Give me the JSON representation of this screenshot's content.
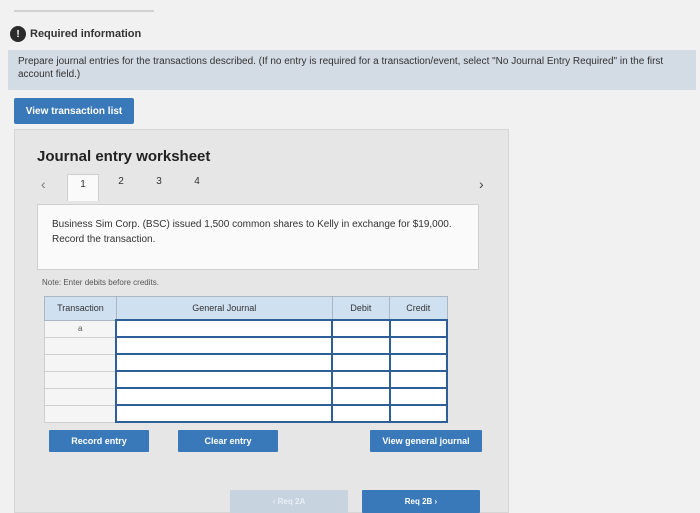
{
  "header": {
    "icon_glyph": "!",
    "title": "Required information"
  },
  "instructions": "Prepare journal entries for the transactions described. (If no entry is required for a transaction/event, select \"No Journal Entry Required\" in the first account field.)",
  "view_transaction_list": "View transaction list",
  "worksheet": {
    "title": "Journal entry worksheet",
    "tabs": [
      "1",
      "2",
      "3",
      "4"
    ],
    "active_tab": "1",
    "description": "Business Sim Corp. (BSC) issued 1,500 common shares to Kelly in exchange for $19,000. Record the transaction.",
    "note": "Note: Enter debits before credits.",
    "table": {
      "headers": [
        "Transaction",
        "General Journal",
        "Debit",
        "Credit"
      ],
      "rows": [
        {
          "transaction": "a",
          "account": "",
          "debit": "",
          "credit": ""
        },
        {
          "transaction": "",
          "account": "",
          "debit": "",
          "credit": ""
        },
        {
          "transaction": "",
          "account": "",
          "debit": "",
          "credit": ""
        },
        {
          "transaction": "",
          "account": "",
          "debit": "",
          "credit": ""
        },
        {
          "transaction": "",
          "account": "",
          "debit": "",
          "credit": ""
        },
        {
          "transaction": "",
          "account": "",
          "debit": "",
          "credit": ""
        }
      ]
    },
    "buttons": {
      "record": "Record entry",
      "clear": "Clear entry",
      "view_general": "View general journal"
    }
  },
  "nav": {
    "prev": "Req 2A",
    "next": "Req 2B"
  },
  "colors": {
    "accent": "#3a79b9",
    "instructions_bg": "#d3dbe4",
    "table_header": "#cfe0f1"
  }
}
